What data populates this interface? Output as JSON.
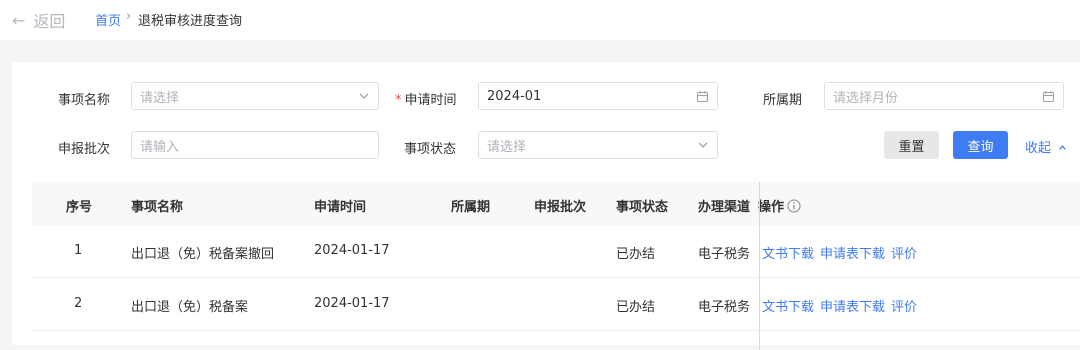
{
  "header": {
    "back_label": "返回",
    "breadcrumb": {
      "home": "首页",
      "separator": "›",
      "current": "退税审核进度查询"
    }
  },
  "filters": {
    "item_name": {
      "label": "事项名称",
      "placeholder": "请选择"
    },
    "apply_time": {
      "label": "申请时间",
      "required_mark": "*",
      "value": "2024-01"
    },
    "period": {
      "label": "所属期",
      "placeholder": "请选择月份"
    },
    "batch": {
      "label": "申报批次",
      "placeholder": "请输入"
    },
    "status": {
      "label": "事项状态",
      "placeholder": "请选择"
    },
    "reset_label": "重置",
    "query_label": "查询",
    "collapse_label": "收起"
  },
  "table": {
    "columns": [
      "序号",
      "事项名称",
      "申请时间",
      "所属期",
      "申报批次",
      "事项状态",
      "办理渠道",
      "操作"
    ],
    "rows": [
      {
        "index": "1",
        "name": "出口退（免）税备案撤回",
        "time": "2024-01-17",
        "period": "",
        "batch": "",
        "status": "已办结",
        "channel": "电子税务",
        "actions": [
          "文书下载",
          "申请表下载",
          "评价"
        ]
      },
      {
        "index": "2",
        "name": "出口退（免）税备案",
        "time": "2024-01-17",
        "period": "",
        "batch": "",
        "status": "已办结",
        "channel": "电子税务",
        "actions": [
          "文书下载",
          "申请表下载",
          "评价"
        ]
      }
    ]
  },
  "colors": {
    "accent": "#3e7cf4",
    "required": "#e74c3c"
  }
}
